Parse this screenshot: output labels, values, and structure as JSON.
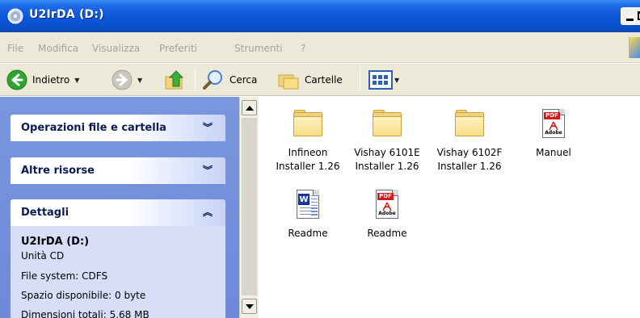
{
  "window": {
    "title": "U2IrDA (D:)"
  },
  "menu": [
    "File",
    "Modifica",
    "Visualizza",
    "Preferiti",
    "Strumenti",
    "?"
  ],
  "toolbar": {
    "back": "Indietro",
    "search": "Cerca",
    "folders": "Cartelle"
  },
  "taskpane": {
    "sections": [
      "Operazioni file e cartella",
      "Altre risorse",
      "Dettagli"
    ],
    "details": {
      "name": "U2IrDA (D:)",
      "type": "Unità CD",
      "filesystem": "File system: CDFS",
      "free": "Spazio disponibile: 0 byte",
      "total": "Dimensioni totali: 5,68 MB"
    }
  },
  "files": [
    {
      "label": "Infineon Installer 1.26",
      "line1": "Infineon",
      "line2": "Installer 1.26",
      "icon": "folder-icon"
    },
    {
      "label": "Vishay 6101E Installer 1.26",
      "line1": "Vishay 6101E",
      "line2": "Installer 1.26",
      "icon": "folder-icon"
    },
    {
      "label": "Vishay 6102F Installer 1.26",
      "line1": "Vishay 6102F",
      "line2": "Installer 1.26",
      "icon": "folder-icon"
    },
    {
      "label": "Manuel",
      "line1": "Manuel",
      "line2": "",
      "icon": "pdf-file-icon"
    },
    {
      "label": "Readme",
      "line1": "Readme",
      "line2": "",
      "icon": "word-file-icon"
    },
    {
      "label": "Readme",
      "line1": "Readme",
      "line2": "",
      "icon": "pdf-file-icon"
    }
  ],
  "colors": {
    "titlebar": "#0a56d8",
    "taskpane": "#7a96df",
    "menubar": "#ece9d8",
    "pdf_red": "#d11a1a"
  }
}
